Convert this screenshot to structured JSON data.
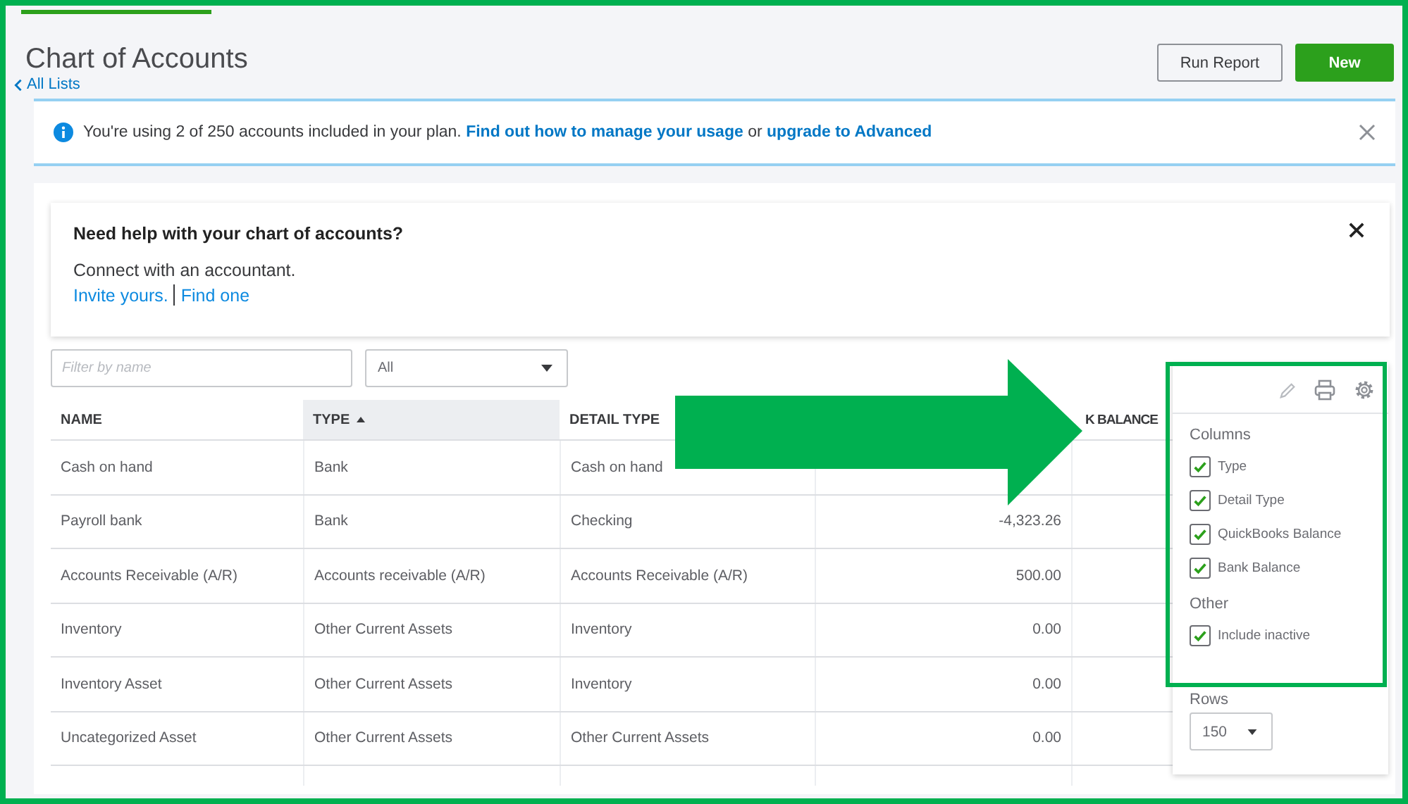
{
  "page": {
    "title": "Chart of Accounts",
    "back_link": "All Lists"
  },
  "buttons": [
    {
      "label": "Run Report",
      "kind": "secondary"
    },
    {
      "label": "New",
      "kind": "primary"
    }
  ],
  "banner": {
    "segments": [
      {
        "kind": "text",
        "text": "You're using 2 of 250 accounts included in your plan."
      },
      {
        "kind": "link",
        "text": "Find out how to manage your usage"
      },
      {
        "kind": "text",
        "text": "or"
      },
      {
        "kind": "link",
        "text": "upgrade to Advanced"
      }
    ]
  },
  "help_card": {
    "title": "Need help with your chart of accounts?",
    "text": "Connect with an accountant.",
    "links": [
      "Invite yours.",
      "Find one"
    ]
  },
  "filter": {
    "placeholder": "Filter by name"
  },
  "type_select": {
    "value": "All"
  },
  "table": {
    "columns": [
      {
        "label": "NAME",
        "sorted": false
      },
      {
        "label": "TYPE",
        "sorted": true
      },
      {
        "label": "DETAIL TYPE",
        "sorted": false
      },
      {
        "label": "K BALANCE",
        "sorted": false
      }
    ],
    "rows": [
      {
        "name": "Cash on hand",
        "type": "Bank",
        "detail_type": "Cash on hand"
      },
      {
        "name": "Payroll bank",
        "type": "Bank",
        "detail_type": "Checking",
        "balance": "-4,323.26"
      },
      {
        "name": "Accounts Receivable (A/R)",
        "type": "Accounts receivable (A/R)",
        "detail_type": "Accounts Receivable (A/R)",
        "balance": "500.00"
      },
      {
        "name": "Inventory",
        "type": "Other Current Assets",
        "detail_type": "Inventory",
        "balance": "0.00"
      },
      {
        "name": "Inventory Asset",
        "type": "Other Current Assets",
        "detail_type": "Inventory",
        "balance": "0.00"
      },
      {
        "name": "Uncategorized Asset",
        "type": "Other Current Assets",
        "detail_type": "Other Current Assets",
        "balance": "0.00"
      }
    ]
  },
  "settings": {
    "sections": [
      {
        "title": "Columns",
        "options": [
          {
            "label": "Type",
            "checked": true
          },
          {
            "label": "Detail Type",
            "checked": true
          },
          {
            "label": "QuickBooks Balance",
            "checked": true
          },
          {
            "label": "Bank Balance",
            "checked": true
          }
        ]
      },
      {
        "title": "Other",
        "options": [
          {
            "label": "Include inactive",
            "checked": true
          }
        ]
      }
    ],
    "rows": {
      "label": "Rows",
      "value": "150"
    }
  }
}
